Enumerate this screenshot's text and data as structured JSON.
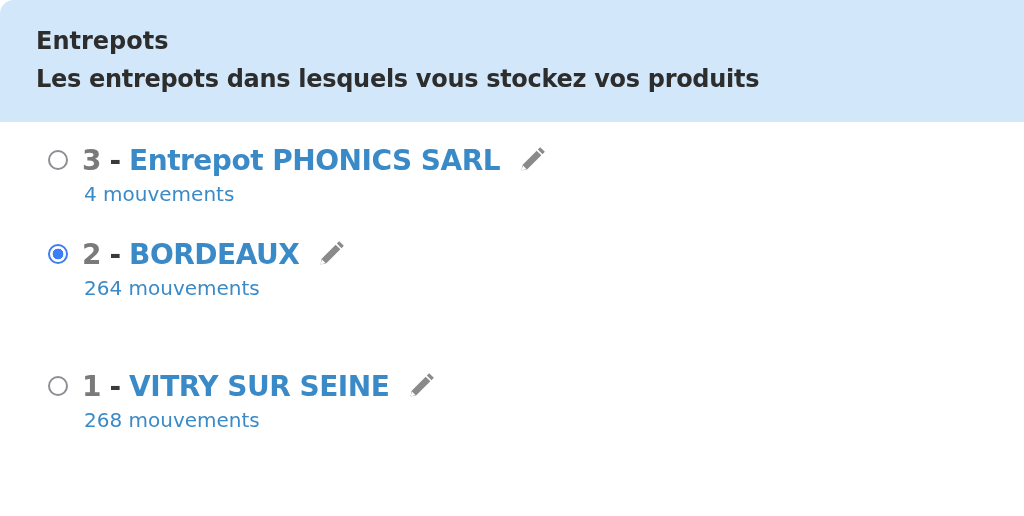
{
  "header": {
    "title": "Entrepots",
    "subtitle": "Les entrepots dans lesquels vous stockez vos produits"
  },
  "warehouses": [
    {
      "number": "3",
      "separator": "-",
      "name": "Entrepot PHONICS SARL",
      "movements": "4 mouvements",
      "selected": false
    },
    {
      "number": "2",
      "separator": "-",
      "name": "BORDEAUX",
      "movements": "264 mouvements",
      "selected": true
    },
    {
      "number": "1",
      "separator": "-",
      "name": "VITRY SUR SEINE",
      "movements": "268 mouvements",
      "selected": false
    }
  ]
}
